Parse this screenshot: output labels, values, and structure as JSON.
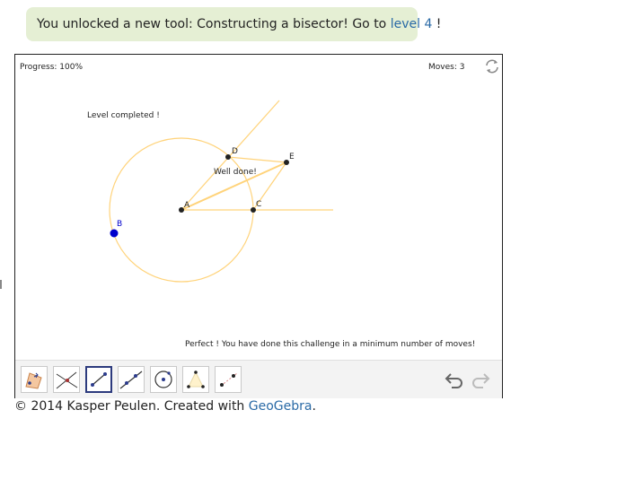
{
  "banner": {
    "text_before": "You unlocked a new tool: Constructing a bisector! Go to ",
    "link_label": "level 4",
    "text_after": " !"
  },
  "applet": {
    "progress": "Progress: 100%",
    "moves": "Moves: 3",
    "reset_icon": "refresh-icon",
    "canvas": {
      "level_text": "Level completed !",
      "well_done_text": "Well done!",
      "perfect_text": "Perfect ! You have done this challenge in a minimum number of moves!",
      "points": [
        {
          "label": "A",
          "color": "#222222"
        },
        {
          "label": "B",
          "color": "#0000cc"
        },
        {
          "label": "C",
          "color": "#222222"
        },
        {
          "label": "D",
          "color": "#222222"
        },
        {
          "label": "E",
          "color": "#222222"
        }
      ],
      "construction_color": "#ffd37a"
    },
    "toolbar": {
      "tools": [
        {
          "name": "move-tool",
          "icon": "move-polygon-icon"
        },
        {
          "name": "intersect-tool",
          "icon": "intersect-icon"
        },
        {
          "name": "segment-tool",
          "icon": "segment-icon",
          "selected": true
        },
        {
          "name": "line-tool",
          "icon": "line-icon"
        },
        {
          "name": "circle-tool",
          "icon": "circle-icon"
        },
        {
          "name": "bisector-tool",
          "icon": "angle-bisector-icon"
        },
        {
          "name": "ray-tool",
          "icon": "ray-icon"
        }
      ],
      "undo_icon": "undo-icon",
      "redo_icon": "redo-icon"
    }
  },
  "footer": {
    "text": "© 2014 Kasper Peulen. Created with ",
    "link_label": "GeoGebra",
    "text_after": "."
  },
  "colors": {
    "banner_bg": "#e5efd4",
    "link": "#2a6aa6",
    "selected_tool_border": "#2c3a7d"
  }
}
